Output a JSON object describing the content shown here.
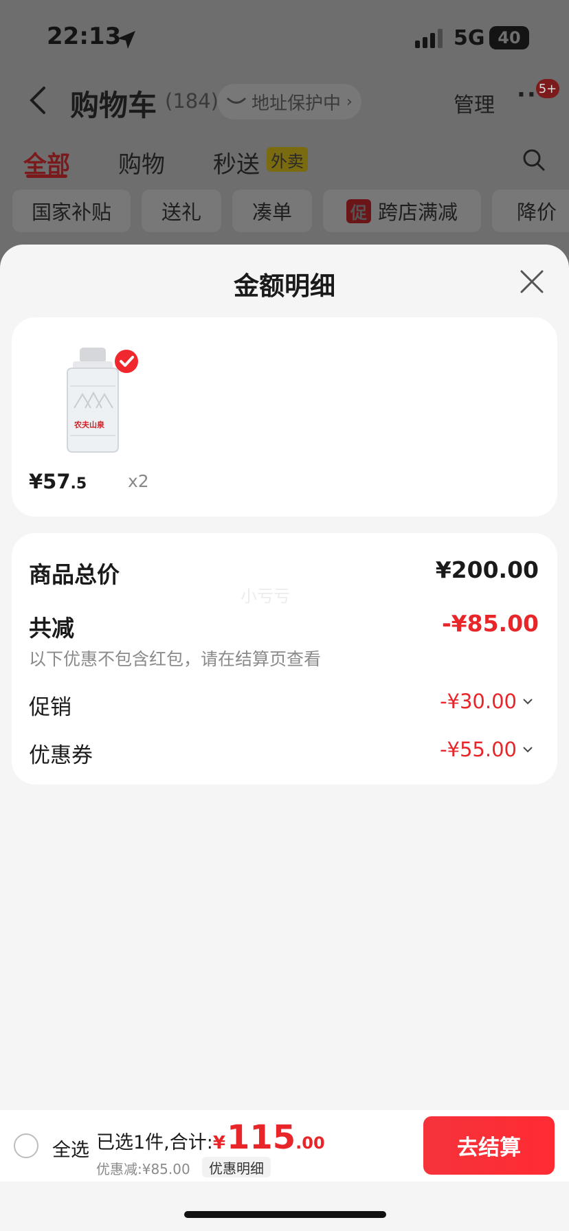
{
  "status_bar": {
    "time": "22:13",
    "network": "5G",
    "battery": "40"
  },
  "header": {
    "back_icon": "chevron-left-icon",
    "title": "购物车",
    "count": "(184)",
    "address_label": "地址保护中",
    "manage_label": "管理",
    "more_badge": "5+"
  },
  "tabs": [
    {
      "label": "全部",
      "active": true
    },
    {
      "label": "购物"
    },
    {
      "label": "秒送",
      "tag": "外卖"
    }
  ],
  "chips": [
    "国家补贴",
    "送礼",
    "凑单",
    "跨店满减",
    "降价"
  ],
  "chip_promo_tag": "促",
  "sheet": {
    "title": "金额明细",
    "product": {
      "brand_text": "农夫山泉",
      "price_int": "¥57",
      "price_dec": ".5",
      "quantity": "x2"
    },
    "summary": {
      "total_label": "商品总价",
      "total_value": "¥200.00",
      "watermark": "小亏亏",
      "discount_label": "共减",
      "discount_value": "-¥85.00",
      "note": "以下优惠不包含红包，请在结算页查看",
      "rows": [
        {
          "label": "促销",
          "value": "-¥30.00"
        },
        {
          "label": "优惠券",
          "value": "-¥55.00"
        }
      ]
    }
  },
  "bottom": {
    "select_all": "全选",
    "selected_text": "已选1件,合计:",
    "currency": "¥",
    "total_int": "115",
    "total_dec": ".00",
    "discount_text": "优惠减:¥85.00",
    "detail_label": "优惠明细",
    "checkout_label": "去结算"
  },
  "colors": {
    "accent": "#e8262a",
    "sheet_bg": "#f5f5f5",
    "dim_bg": "#6e6e6e"
  }
}
